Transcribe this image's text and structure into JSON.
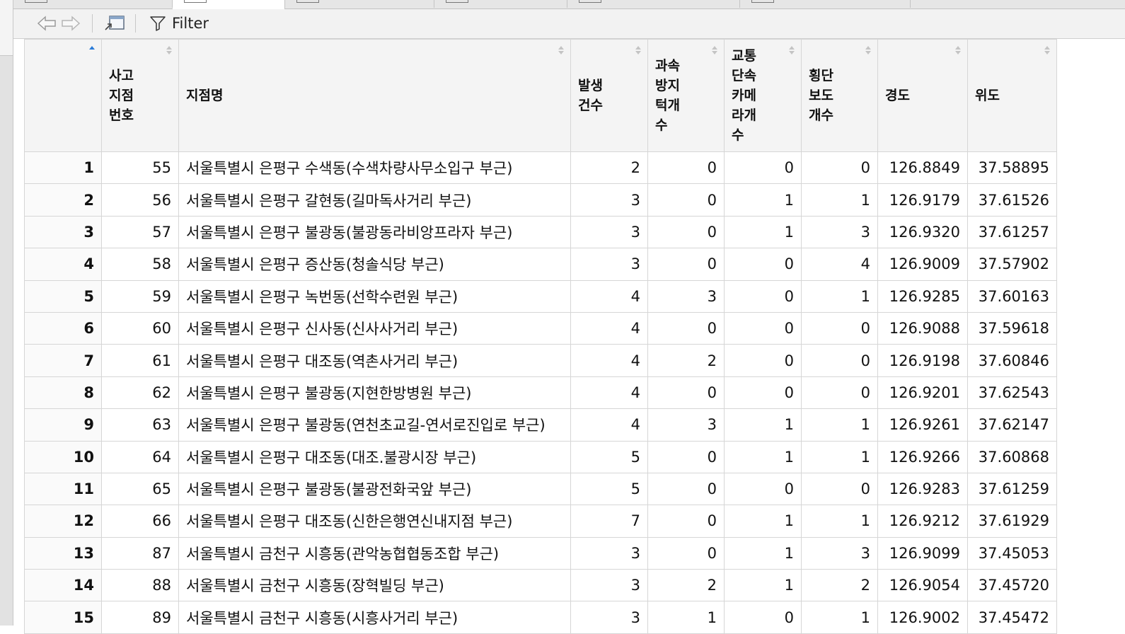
{
  "toolbar": {
    "back_icon": "back-arrow-icon",
    "forward_icon": "forward-arrow-icon",
    "popout_icon": "show-in-window-icon",
    "filter_icon": "funnel-icon",
    "filter_label": "Filter"
  },
  "table": {
    "columns": [
      "",
      "사고\n지점\n번호",
      "지점명",
      "발생\n건수",
      "과속\n방지\n턱개\n수",
      "교통\n단속\n카메\n라개\n수",
      "횡단\n보도\n개수",
      "경도",
      "위도"
    ],
    "sort_column": 0,
    "sort_direction": "ascending",
    "rows": [
      [
        "1",
        "55",
        "서울특별시 은평구 수색동(수색차량사무소입구 부근)",
        "2",
        "0",
        "0",
        "0",
        "126.8849",
        "37.58895"
      ],
      [
        "2",
        "56",
        "서울특별시 은평구 갈현동(길마독사거리 부근)",
        "3",
        "0",
        "1",
        "1",
        "126.9179",
        "37.61526"
      ],
      [
        "3",
        "57",
        "서울특별시 은평구 불광동(불광동라비앙프라자 부근)",
        "3",
        "0",
        "1",
        "3",
        "126.9320",
        "37.61257"
      ],
      [
        "4",
        "58",
        "서울특별시 은평구 증산동(청솔식당 부근)",
        "3",
        "0",
        "0",
        "4",
        "126.9009",
        "37.57902"
      ],
      [
        "5",
        "59",
        "서울특별시 은평구 녹번동(선학수련원 부근)",
        "4",
        "3",
        "0",
        "1",
        "126.9285",
        "37.60163"
      ],
      [
        "6",
        "60",
        "서울특별시 은평구 신사동(신사사거리 부근)",
        "4",
        "0",
        "0",
        "0",
        "126.9088",
        "37.59618"
      ],
      [
        "7",
        "61",
        "서울특별시 은평구 대조동(역촌사거리 부근)",
        "4",
        "2",
        "0",
        "0",
        "126.9198",
        "37.60846"
      ],
      [
        "8",
        "62",
        "서울특별시 은평구 불광동(지현한방병원 부근)",
        "4",
        "0",
        "0",
        "0",
        "126.9201",
        "37.62543"
      ],
      [
        "9",
        "63",
        "서울특별시 은평구 불광동(연천초교길-연서로진입로 부근)",
        "4",
        "3",
        "1",
        "1",
        "126.9261",
        "37.62147"
      ],
      [
        "10",
        "64",
        "서울특별시 은평구 대조동(대조.불광시장 부근)",
        "5",
        "0",
        "1",
        "1",
        "126.9266",
        "37.60868"
      ],
      [
        "11",
        "65",
        "서울특별시 은평구 불광동(불광전화국앞 부근)",
        "5",
        "0",
        "0",
        "0",
        "126.9283",
        "37.61259"
      ],
      [
        "12",
        "66",
        "서울특별시 은평구 대조동(신한은행연신내지점 부근)",
        "7",
        "0",
        "1",
        "1",
        "126.9212",
        "37.61929"
      ],
      [
        "13",
        "87",
        "서울특별시 금천구 시흥동(관악농협협동조합 부근)",
        "3",
        "0",
        "1",
        "3",
        "126.9099",
        "37.45053"
      ],
      [
        "14",
        "88",
        "서울특별시 금천구 시흥동(장혁빌딩 부근)",
        "3",
        "2",
        "1",
        "2",
        "126.9054",
        "37.45720"
      ],
      [
        "15",
        "89",
        "서울특별시 금천구 시흥동(시흥사거리 부근)",
        "3",
        "1",
        "0",
        "1",
        "126.9002",
        "37.45472"
      ]
    ]
  }
}
